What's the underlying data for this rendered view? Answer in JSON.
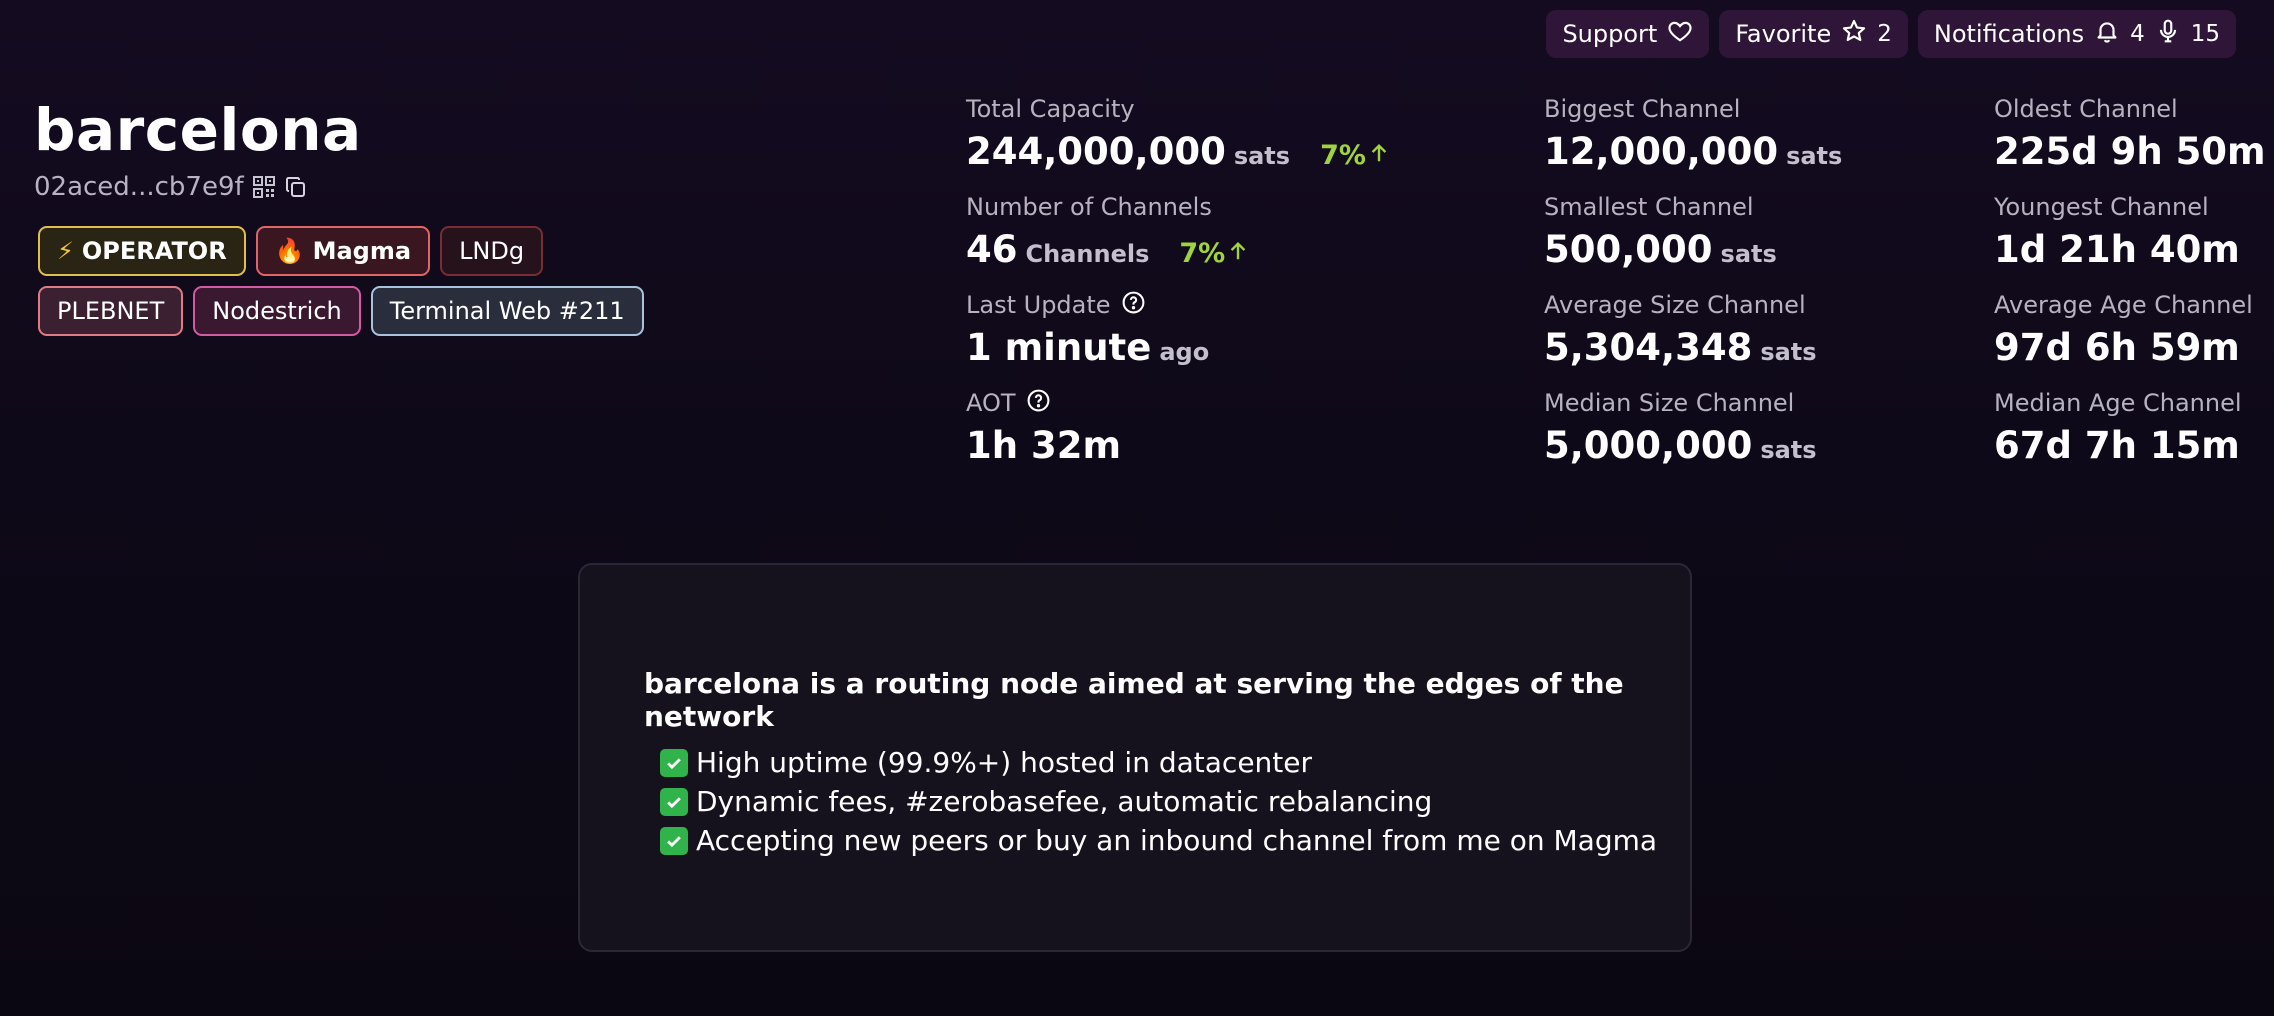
{
  "top_actions": {
    "support_label": "Support",
    "favorite_label": "Favorite",
    "favorite_count": "2",
    "notifications_label": "Notifications",
    "bell_count": "4",
    "mic_count": "15"
  },
  "node": {
    "alias": "barcelona",
    "pubkey_short": "02aced...cb7e9f"
  },
  "tags": [
    {
      "label": "OPERATOR",
      "icon": "lightning-icon"
    },
    {
      "label": "Magma",
      "icon": "fire-icon"
    },
    {
      "label": "LNDg"
    },
    {
      "label": "PLEBNET"
    },
    {
      "label": "Nodestrich"
    },
    {
      "label": "Terminal Web #211"
    }
  ],
  "stats": {
    "total_capacity": {
      "label": "Total Capacity",
      "value": "244,000,000",
      "unit": "sats",
      "delta": "7%"
    },
    "num_channels": {
      "label": "Number of Channels",
      "value": "46",
      "unit": "Channels",
      "delta": "7%"
    },
    "last_update": {
      "label": "Last Update",
      "value": "1 minute",
      "unit": "ago"
    },
    "aot": {
      "label": "AOT",
      "value": "1h 32m"
    },
    "biggest": {
      "label": "Biggest Channel",
      "value": "12,000,000",
      "unit": "sats"
    },
    "smallest": {
      "label": "Smallest Channel",
      "value": "500,000",
      "unit": "sats"
    },
    "average_size": {
      "label": "Average Size Channel",
      "value": "5,304,348",
      "unit": "sats"
    },
    "median_size": {
      "label": "Median Size Channel",
      "value": "5,000,000",
      "unit": "sats"
    },
    "oldest": {
      "label": "Oldest Channel",
      "value": "225d 9h 50m"
    },
    "youngest": {
      "label": "Youngest Channel",
      "value": "1d 21h 40m"
    },
    "average_age": {
      "label": "Average Age Channel",
      "value": "97d 6h 59m"
    },
    "median_age": {
      "label": "Median Age Channel",
      "value": "67d 7h 15m"
    }
  },
  "description": {
    "title": "barcelona is a routing node aimed at serving the edges of the network",
    "items": [
      "High uptime (99.9%+) hosted in datacenter",
      "Dynamic fees, #zerobasefee, automatic rebalancing",
      "Accepting new peers or buy an inbound channel from me on Magma"
    ]
  },
  "colors": {
    "background": "#0e0918",
    "action_button": "#2f1638",
    "delta_green": "#9fd43c",
    "card_bg": "#15121d"
  }
}
